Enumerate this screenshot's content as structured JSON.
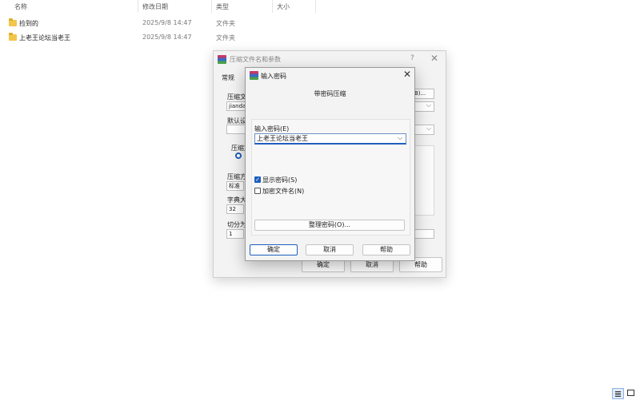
{
  "explorer": {
    "columns": {
      "name": "名称",
      "date": "修改日期",
      "type": "类型",
      "size": "大小"
    },
    "rows": [
      {
        "name": "捡到的",
        "date": "2025/9/8 14:47",
        "type": "文件夹"
      },
      {
        "name": "上老王论坛当老王",
        "date": "2025/9/8 14:47",
        "type": "文件夹"
      }
    ]
  },
  "archive_dialog": {
    "title": "压缩文件名和参数",
    "help": "?",
    "close": "✕",
    "tab": "常规",
    "archive_label": "压缩文",
    "archive_value": "jiandao",
    "browse_label": "B)...",
    "default_label": "默认设",
    "format_label": "压缩文",
    "method_label": "压缩方",
    "method_value": "标准",
    "dict_label": "字典大",
    "dict_value": "32",
    "split_label": "切分为",
    "split_value": "1",
    "buttons": {
      "ok": "确定",
      "cancel": "取消",
      "help": "帮助"
    }
  },
  "password_dialog": {
    "title": "输入密码",
    "close": "✕",
    "heading": "带密码压缩",
    "password_label": "输入密码(E)",
    "password_value": "上老王论坛当老王",
    "show_password": {
      "label": "显示密码(S)",
      "checked": true
    },
    "encrypt_names": {
      "label": "加密文件名(N)",
      "checked": false
    },
    "organize_button": "整理密码(O)...",
    "buttons": {
      "ok": "确定",
      "cancel": "取消",
      "help": "帮助"
    }
  },
  "icons": {
    "folder": "folder-icon",
    "sort": "chevron-down-icon",
    "view_details": "details-view-icon",
    "view_tiles": "tiles-view-icon"
  },
  "colors": {
    "accent": "#1f5fbf",
    "folder": "#f2c54b"
  }
}
